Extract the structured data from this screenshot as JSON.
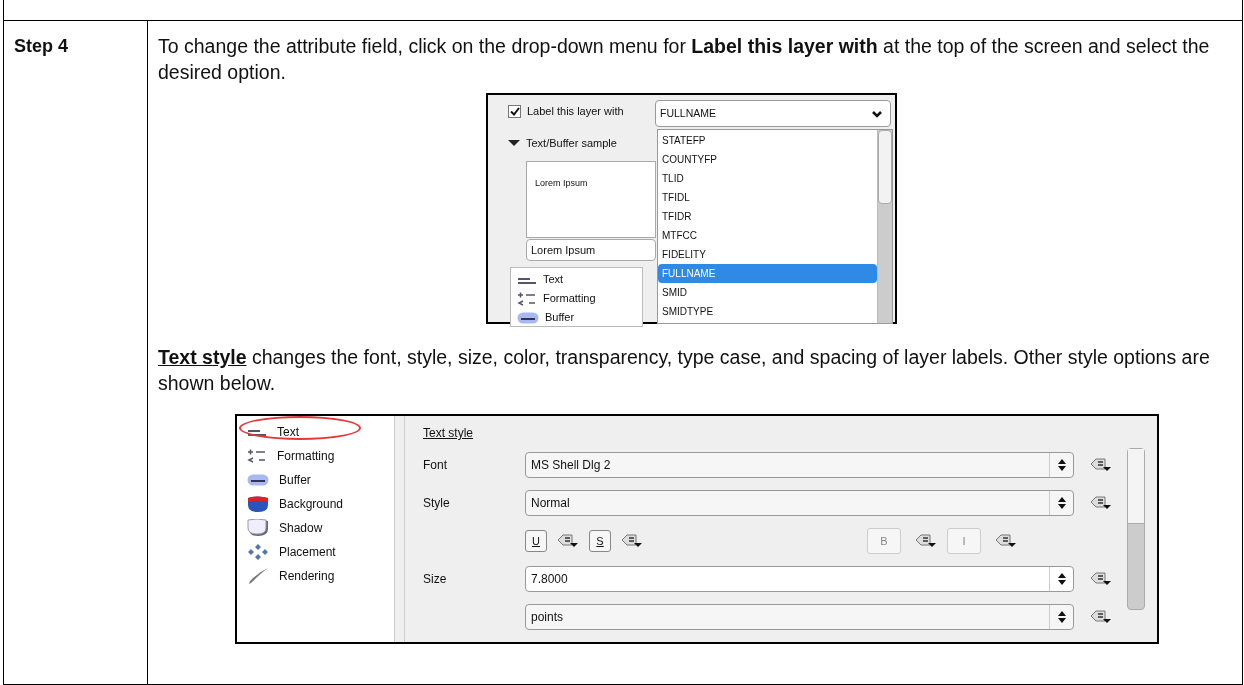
{
  "step": {
    "label": "Step 4",
    "intro": "To change the attribute field, click on the drop-down menu for **Label this layer with** at the top of the screen and select the desired option.",
    "label_dialog": {
      "checkbox": {
        "label": "Label this layer with",
        "checked": true
      },
      "combo_value": "FULLNAME",
      "section": {
        "label": "Text/Buffer sample",
        "expanded": true
      },
      "sample_preview": "Lorem Ipsum",
      "sample_field": "Lorem Ipsum",
      "nav_items": [
        {
          "label": "Text",
          "kind": "text"
        },
        {
          "label": "Formatting",
          "kind": "formatting"
        },
        {
          "label": "Buffer",
          "kind": "buffer"
        }
      ],
      "dropdown_items": [
        {
          "label": "STATEFP",
          "selected": false
        },
        {
          "label": "COUNTYFP",
          "selected": false
        },
        {
          "label": "TLID",
          "selected": false
        },
        {
          "label": "TFIDL",
          "selected": false
        },
        {
          "label": "TFIDR",
          "selected": false
        },
        {
          "label": "MTFCC",
          "selected": false
        },
        {
          "label": "FIDELITY",
          "selected": false
        },
        {
          "label": "FULLNAME",
          "selected": true
        },
        {
          "label": "SMID",
          "selected": false
        },
        {
          "label": "SMIDTYPE",
          "selected": false
        }
      ]
    },
    "description": "**Text style** changes the font, style, size, color, transparency, type case, and spacing of layer labels. Other style options are shown below.",
    "style_dialog": {
      "nav_items": [
        {
          "label": "Text",
          "kind": "text",
          "circled": true
        },
        {
          "label": "Formatting",
          "kind": "formatting",
          "circled": false
        },
        {
          "label": "Buffer",
          "kind": "buffer",
          "circled": false
        },
        {
          "label": "Background",
          "kind": "background",
          "circled": false
        },
        {
          "label": "Shadow",
          "kind": "shadow",
          "circled": false
        },
        {
          "label": "Placement",
          "kind": "placement",
          "circled": false
        },
        {
          "label": "Rendering",
          "kind": "rendering",
          "circled": false
        }
      ],
      "heading": "Text style",
      "rows": [
        {
          "kind": "select",
          "label": "Font",
          "value": "MS Shell Dlg 2"
        },
        {
          "kind": "select",
          "label": "Style",
          "value": "Normal"
        },
        {
          "kind": "buttons",
          "left": [
            {
              "label": "U",
              "disabled": false
            },
            {
              "label": "S",
              "disabled": false
            }
          ],
          "right": [
            {
              "label": "B",
              "disabled": true
            },
            {
              "label": "I",
              "disabled": true
            }
          ]
        },
        {
          "kind": "spin",
          "label": "Size",
          "value": "7.8000"
        },
        {
          "kind": "select",
          "value": "points"
        }
      ]
    }
  }
}
